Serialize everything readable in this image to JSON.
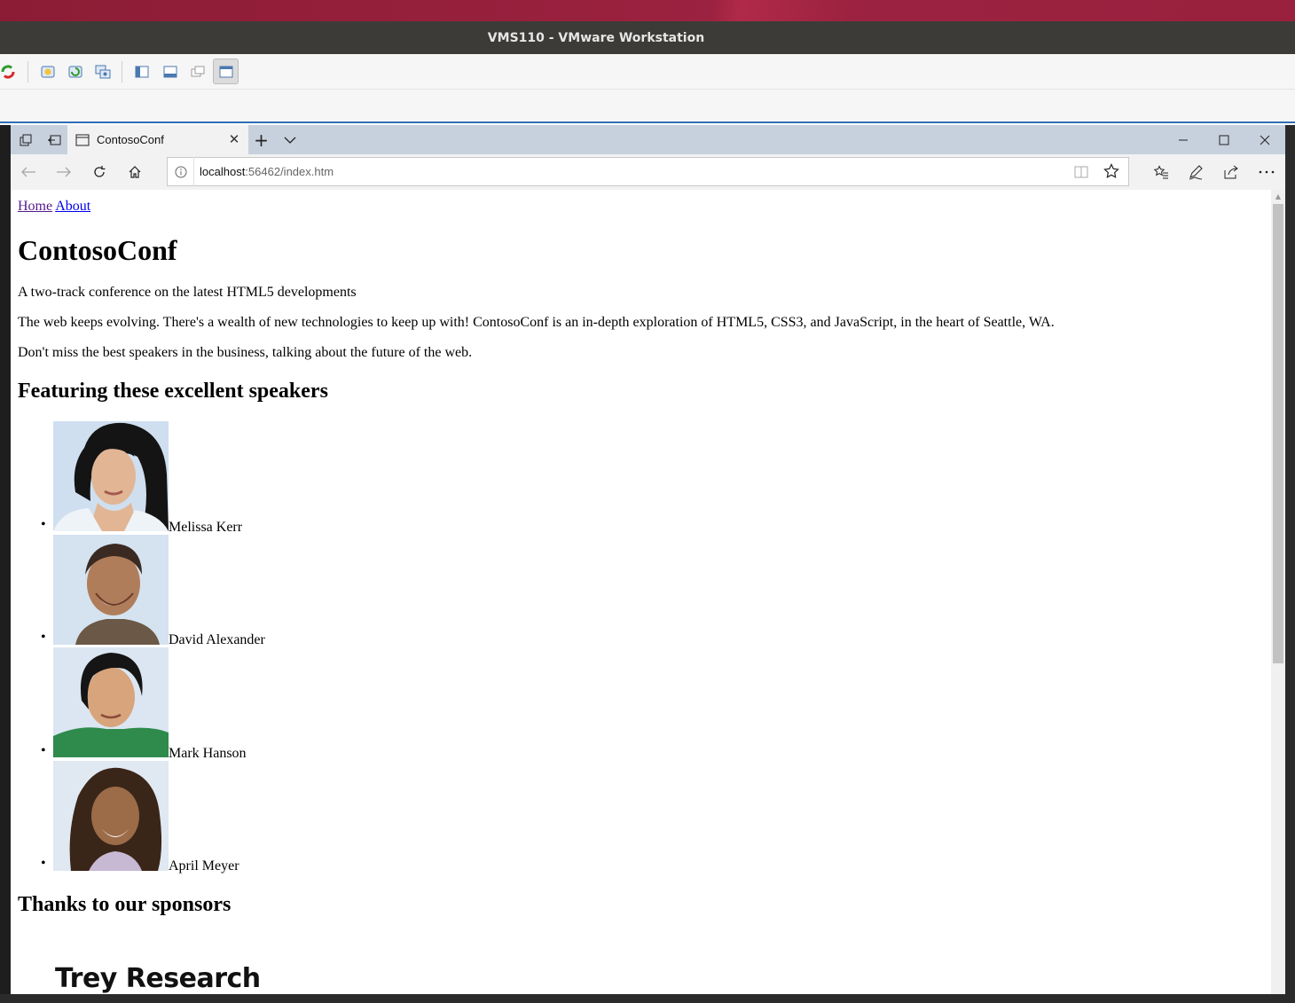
{
  "host": {
    "window_title": "VMS110 - VMware Workstation",
    "toolbar_icons": [
      "power-icon",
      "snapshot-icon",
      "revert-snapshot-icon",
      "snapshot-manager-icon",
      "library-view-icon",
      "thumbnail-bar-icon",
      "unity-icon",
      "fullscreen-icon"
    ]
  },
  "browser": {
    "tab_title": "ContosoConf",
    "url_host": "localhost",
    "url_rest": ":56462/index.htm",
    "colors": {
      "tabbar": "#c7d1dd",
      "active_tab": "#f2f2f2",
      "visited_link": "#551a8b",
      "link": "#0000ee"
    }
  },
  "page": {
    "nav": {
      "home": "Home",
      "about": "About"
    },
    "title": "ContosoConf",
    "tagline": "A two-track conference on the latest HTML5 developments",
    "intro": "The web keeps evolving. There's a wealth of new technologies to keep up with! ContosoConf is an in-depth exploration of HTML5, CSS3, and JavaScript, in the heart of Seattle, WA.",
    "cta": "Don't miss the best speakers in the business, talking about the future of the web.",
    "speakers_heading": "Featuring these excellent speakers",
    "speakers": [
      {
        "name": "Melissa Kerr"
      },
      {
        "name": "David Alexander"
      },
      {
        "name": "Mark Hanson"
      },
      {
        "name": "April Meyer"
      }
    ],
    "sponsors_heading": "Thanks to our sponsors",
    "sponsor_logo": "Trey Research"
  }
}
